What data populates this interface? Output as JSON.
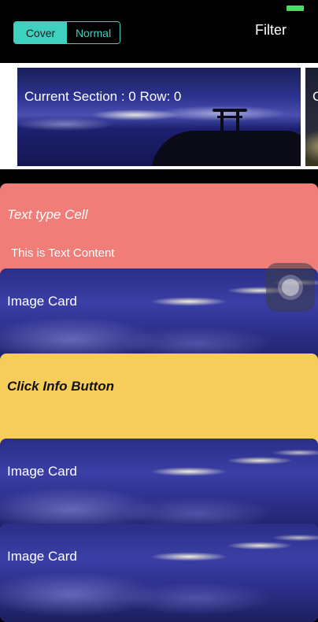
{
  "segment": {
    "options": [
      "Cover",
      "Normal"
    ],
    "selected": "Cover"
  },
  "nav": {
    "filter_label": "Filter"
  },
  "banners": [
    {
      "caption": "Current Section : 0 Row: 0"
    },
    {
      "caption": "C"
    }
  ],
  "cards": {
    "text_card": {
      "title": "Text type Cell",
      "content": "This is Text Content",
      "color": "#f07d78"
    },
    "image_cards": [
      {
        "label": "Image Card"
      },
      {
        "label": "Image Card"
      },
      {
        "label": "Image Card"
      }
    ],
    "info_card": {
      "label": "Click Info Button",
      "color": "#f6cd5b"
    }
  },
  "colors": {
    "accent": "#3fd1c0",
    "battery": "#4cd964"
  },
  "icons": {
    "assistive_touch": "assistive-touch-icon"
  }
}
